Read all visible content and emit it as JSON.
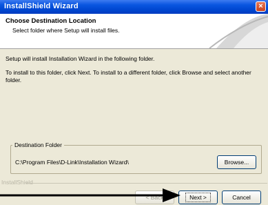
{
  "window": {
    "title": "InstallShield Wizard",
    "close_glyph": "×"
  },
  "header": {
    "title": "Choose Destination Location",
    "subtitle": "Select folder where Setup will install files."
  },
  "body": {
    "line1": "Setup will install Installation Wizard in the following folder.",
    "line2": "To install to this folder, click Next. To install to a different folder, click Browse and select another folder."
  },
  "destination": {
    "legend": "Destination Folder",
    "path": "C:\\Program Files\\D-Link\\Installation Wizard\\",
    "browse_label": "Browse..."
  },
  "footer": {
    "brand": "InstallShield",
    "back_label": "< Back",
    "next_label": "Next >",
    "cancel_label": "Cancel"
  },
  "colors": {
    "titlebar": "#0a56e0",
    "dialog_bg": "#ece9d8",
    "annotation_arrow": "#000000"
  },
  "icons": [
    "close-icon",
    "header-swoosh-art",
    "pointer-arrow"
  ]
}
